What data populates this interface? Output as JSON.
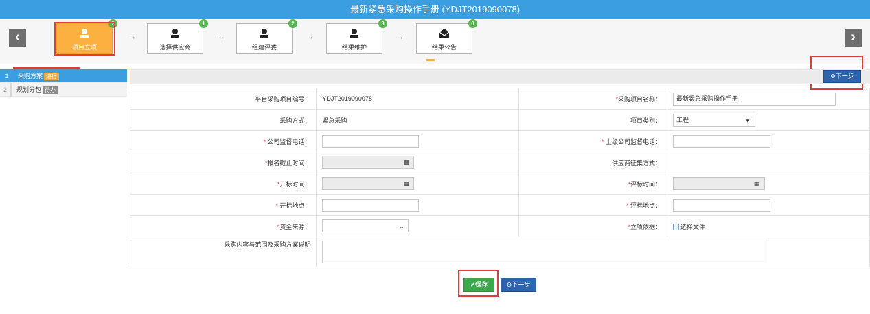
{
  "header": {
    "title": "最新紧急采购操作手册 (YDJT2019090078)"
  },
  "steps": [
    {
      "label": "项目立项",
      "badge": "2",
      "icon": "user-icon"
    },
    {
      "label": "选择供应商",
      "badge": "1",
      "icon": "user-icon"
    },
    {
      "label": "组建评委",
      "badge": "2",
      "icon": "user-icon"
    },
    {
      "label": "结果维护",
      "badge": "3",
      "icon": "user-icon"
    },
    {
      "label": "结果公告",
      "badge": "0",
      "icon": "envelope-icon"
    }
  ],
  "nav": {
    "prev": "‹",
    "next": "›"
  },
  "step_arrow": "→",
  "sidebar": {
    "items": [
      {
        "num": "1",
        "label": "采购方案",
        "tag": "进行"
      },
      {
        "num": "2",
        "label": "规划分包",
        "tag": "待办"
      }
    ]
  },
  "toolbar": {
    "next_label": "下一步"
  },
  "form": {
    "project_no_label": "平台采购项目编号：",
    "project_no_value": "YDJT2019090078",
    "project_name_label": "采购项目名称：",
    "project_name_value": "最新紧急采购操作手册",
    "method_label": "采购方式：",
    "method_value": "紧急采购",
    "category_label": "项目类别：",
    "category_value": "工程",
    "company_phone_label": "公司监督电话：",
    "parent_phone_label": "上级公司监督电话：",
    "deadline_label": "报名截止时间：",
    "supplier_method_label": "供应商征集方式：",
    "open_time_label": "开标时间：",
    "eval_time_label": "评标时间：",
    "open_place_label": "开标地点：",
    "eval_place_label": "评标地点：",
    "fund_label": "资金来源：",
    "basis_label": "立项依据：",
    "basis_file": "选择文件",
    "desc_label": "采购内容与范围及采购方案说明",
    "required_mark": "*"
  },
  "actions": {
    "save_label": "保存",
    "next_label": "下一步"
  },
  "colors": {
    "title_bar": "#3a9ee0",
    "active_step": "#fbb040",
    "badge": "#52b94a",
    "primary_button": "#2e64ad",
    "save_button": "#3aa94b",
    "highlight": "#e23b3b"
  }
}
